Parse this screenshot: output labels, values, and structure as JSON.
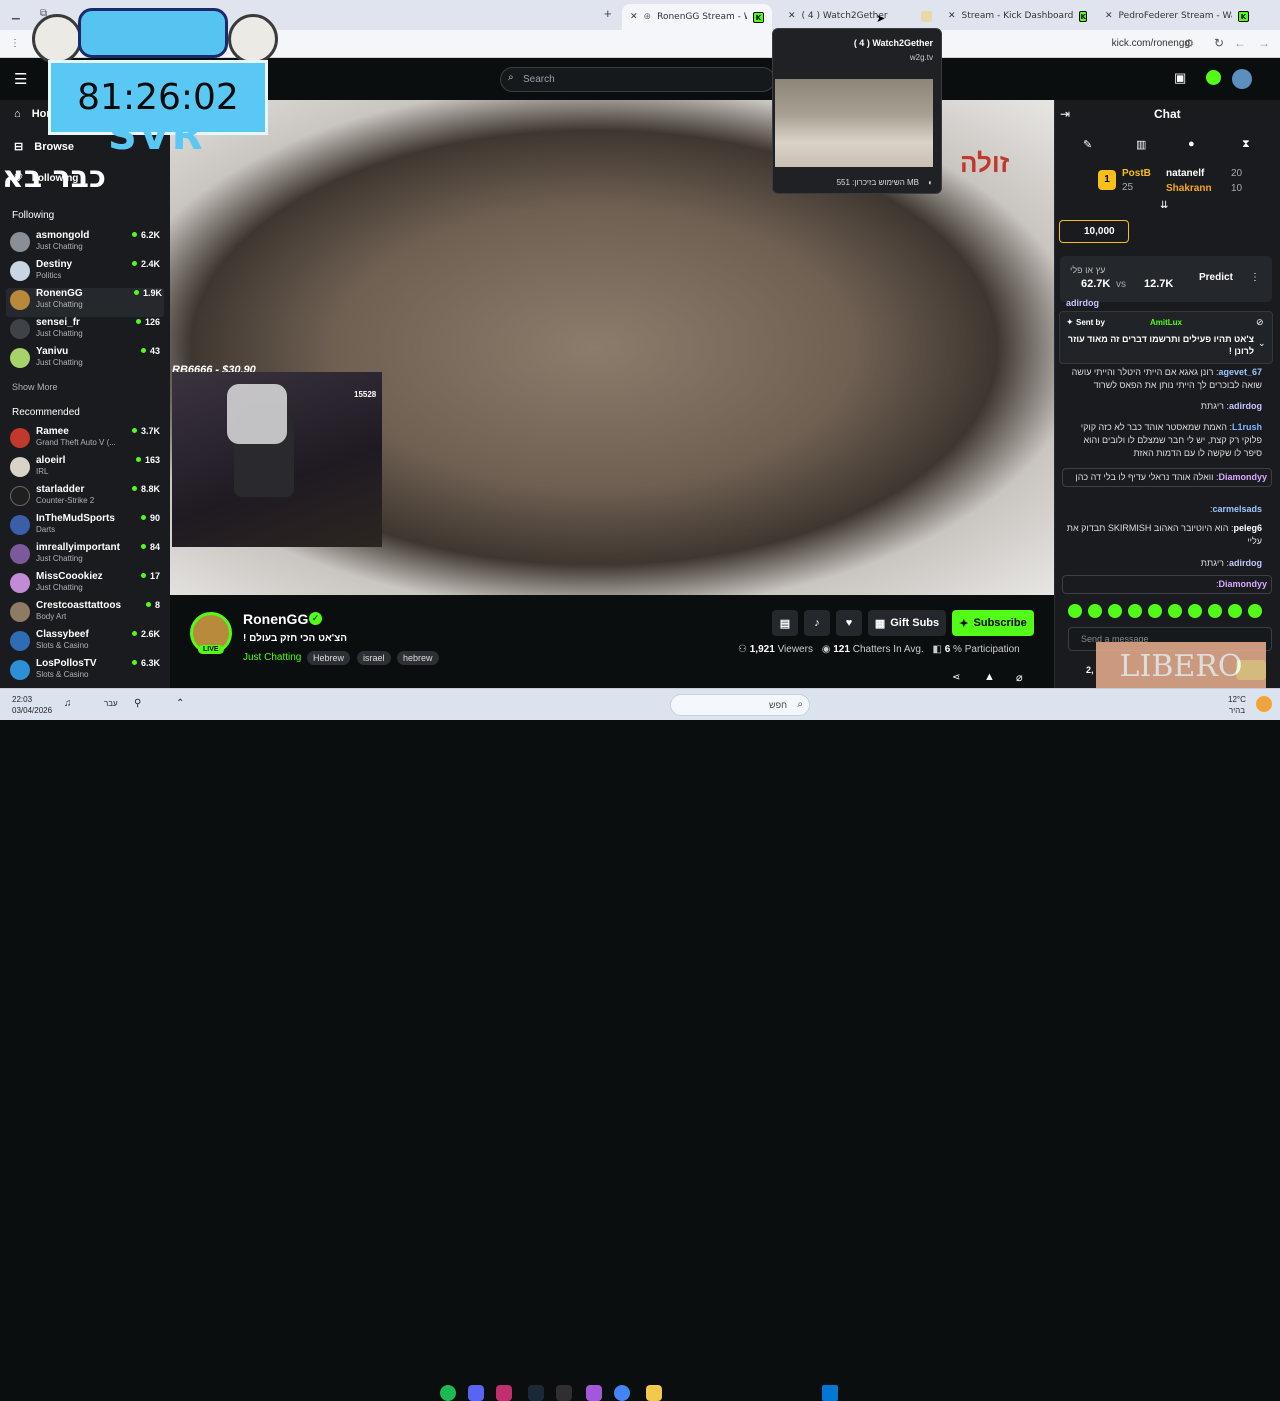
{
  "tabs": [
    {
      "label": "RonenGG Stream - Watch L"
    },
    {
      "label": "( 4 ) Watch2Gether"
    },
    {
      "label": "Stream - Kick Dashboard"
    },
    {
      "label": "PedroFederer Stream - Watch L"
    }
  ],
  "address": {
    "url": "kick.com/ronengg"
  },
  "tooltip": {
    "title": "( 4 ) Watch2Gether",
    "domain": "w2g.tv",
    "memory": "השימוש בזיכרון: 551 MB"
  },
  "overlay": {
    "timer": "81:26:02",
    "logo_text": "SVR",
    "hebrew_text": "כבר בא"
  },
  "topbar": {
    "search_placeholder": "Search"
  },
  "sidebar": {
    "nav": [
      {
        "label": "Home"
      },
      {
        "label": "Browse"
      },
      {
        "label": "Following"
      }
    ],
    "following_title": "Following",
    "following": [
      {
        "name": "asmongold",
        "category": "Just Chatting",
        "viewers": "6.2K"
      },
      {
        "name": "Destiny",
        "category": "Politics",
        "viewers": "2.4K"
      },
      {
        "name": "RonenGG",
        "category": "Just Chatting",
        "viewers": "1.9K"
      },
      {
        "name": "sensei_fr",
        "category": "Just Chatting",
        "viewers": "126"
      },
      {
        "name": "Yanivu",
        "category": "Just Chatting",
        "viewers": "43"
      }
    ],
    "show_more": "Show More",
    "recommended_title": "Recommended",
    "recommended": [
      {
        "name": "Ramee",
        "category": "Grand Theft Auto V (...",
        "viewers": "3.7K"
      },
      {
        "name": "aloeirl",
        "category": "IRL",
        "viewers": "163"
      },
      {
        "name": "starladder",
        "category": "Counter-Strike 2",
        "viewers": "8.8K"
      },
      {
        "name": "InTheMudSports",
        "category": "Darts",
        "viewers": "90"
      },
      {
        "name": "imreallyimportant",
        "category": "Just Chatting",
        "viewers": "84"
      },
      {
        "name": "MissCoookiez",
        "category": "Just Chatting",
        "viewers": "17"
      },
      {
        "name": "Crestcoasttattoos",
        "category": "Body Art",
        "viewers": "8"
      },
      {
        "name": "Classybeef",
        "category": "Slots & Casino",
        "viewers": "2.6K"
      },
      {
        "name": "LosPollosTV",
        "category": "Slots & Casino",
        "viewers": "6.3K"
      }
    ]
  },
  "video": {
    "overlay_text": "RB6666 - $30.90",
    "side_text": "זולה",
    "cam_badge": "15528"
  },
  "stream": {
    "channel": "RonenGG",
    "live": "LIVE",
    "title": "הצ'אט הכי חזק בעולם !",
    "category": "Just Chatting",
    "tags": [
      "Hebrew",
      "israel",
      "hebrew"
    ],
    "gift_subs": "Gift Subs",
    "subscribe": "Subscribe",
    "viewers_count": "1,921",
    "viewers_label": "Viewers",
    "chatters_count": "121",
    "chatters_label": "Chatters In Avg.",
    "participation_count": "6",
    "participation_label": "% Participation"
  },
  "chat": {
    "title": "Chat",
    "leaderboard": [
      {
        "rank": "1",
        "name": "PostB",
        "count": "25"
      },
      {
        "name": "natanelf",
        "count": "20"
      },
      {
        "name": "Shakrann",
        "count": "10"
      }
    ],
    "points": "10,000",
    "predict": {
      "question": "עץ או פלי",
      "left": "62.7K",
      "vs": "vs",
      "right": "12.7K",
      "button": "Predict"
    },
    "pinned": {
      "sent_by": "Sent by",
      "user": "AmitLux",
      "text": "צ'אט תהיו פעילים ותרשמו דברים זה מאוד עוזר לרונן !"
    },
    "partial_user": "adirdog",
    "messages": [
      {
        "user": "agevet_67",
        "text": "רונן גאגא אם הייתי היטלר והייתי עושה שואה לבוכרים לך הייתי נותן את הפאס לשרוד"
      },
      {
        "user": "adirdog",
        "text": "ריגתת"
      },
      {
        "user": "L1rush",
        "text": "האמת שמאסטר אוהד כבר לא כזה קוקי פלוקי רק קצת, יש לי חבר שמצלם לו ולובים והוא סיפר לו שקשה לו עם הדמות האזת"
      },
      {
        "user": "Diamondyy",
        "text": "וואלה אוהד נראלי עדיף לו בלי דה כהן"
      },
      {
        "user": "carmelsads",
        "text": ""
      },
      {
        "user": "peleg6",
        "text": "הוא היוטיובר האהוב SKIRMISH תבדוק את עליי"
      },
      {
        "user": "adirdog",
        "text": "ריגתת"
      },
      {
        "user": "Diamondyy",
        "text": ""
      }
    ],
    "input_placeholder": "Send a message",
    "bottom_count": "2,"
  },
  "taskbar": {
    "time": "22:03",
    "date": "03/04/2026",
    "lang": "עבר",
    "search": "חפש",
    "temp": "12°C",
    "weather": "בהיר"
  },
  "watermark": "LIBERO"
}
